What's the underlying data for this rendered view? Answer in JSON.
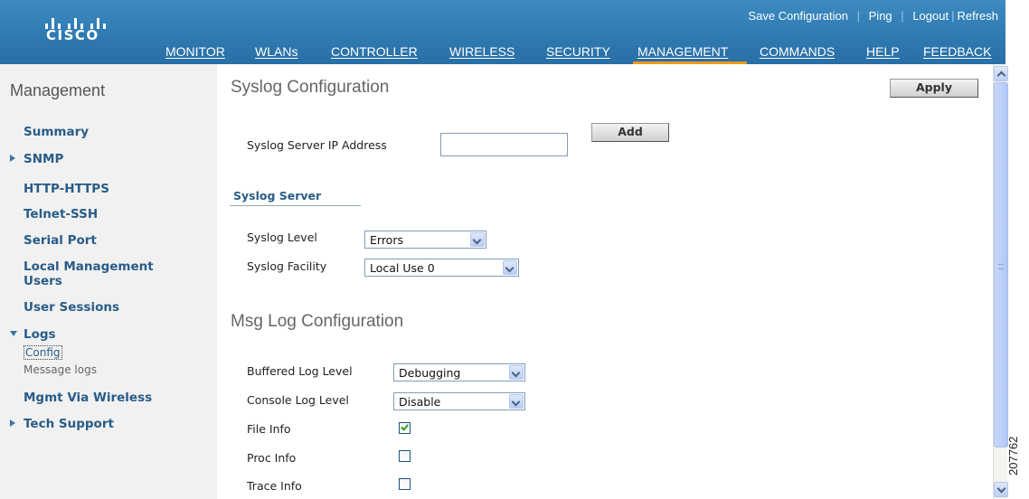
{
  "header": {
    "logo_text": "CISCO",
    "util_links": [
      "Save Configuration",
      "Ping",
      "Logout",
      "Refresh"
    ],
    "nav": [
      "MONITOR",
      "WLANs",
      "CONTROLLER",
      "WIRELESS",
      "SECURITY",
      "MANAGEMENT",
      "COMMANDS",
      "HELP",
      "FEEDBACK"
    ],
    "active_nav": "MANAGEMENT",
    "colors": {
      "header_bg": "#2f7ab2",
      "active_bar": "#f39a1d"
    }
  },
  "sidebar": {
    "title": "Management",
    "items": [
      {
        "label": "Summary",
        "arrow": "none"
      },
      {
        "label": "SNMP",
        "arrow": "collapsed"
      },
      {
        "label": "HTTP-HTTPS",
        "arrow": "none"
      },
      {
        "label": "Telnet-SSH",
        "arrow": "none"
      },
      {
        "label": "Serial Port",
        "arrow": "none"
      },
      {
        "label": "Local Management Users",
        "arrow": "none"
      },
      {
        "label": "User Sessions",
        "arrow": "none"
      },
      {
        "label": "Logs",
        "arrow": "expanded"
      },
      {
        "label": "Mgmt Via Wireless",
        "arrow": "none"
      },
      {
        "label": "Tech Support",
        "arrow": "collapsed"
      }
    ],
    "log_subitems": [
      "Config",
      "Message logs"
    ]
  },
  "main": {
    "title": "Syslog Configuration",
    "apply_label": "Apply",
    "add_label": "Add",
    "server_ip_label": "Syslog Server IP Address",
    "server_ip_value": "",
    "syslog_server_header": "Syslog Server",
    "syslog_level_label": "Syslog Level",
    "syslog_level_value": "Errors",
    "syslog_facility_label": "Syslog Facility",
    "syslog_facility_value": "Local Use 0",
    "msg_title": "Msg Log Configuration",
    "buffered_label": "Buffered Log Level",
    "buffered_value": "Debugging",
    "console_label": "Console Log Level",
    "console_value": "Disable",
    "file_info_label": "File Info",
    "file_info_checked": true,
    "proc_info_label": "Proc Info",
    "proc_info_checked": false,
    "trace_info_label": "Trace Info",
    "trace_info_checked": false
  },
  "figure_id": "207762"
}
